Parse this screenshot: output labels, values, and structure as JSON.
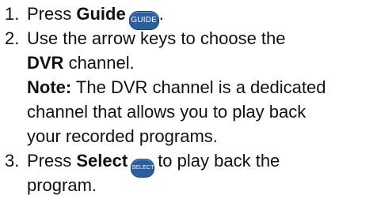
{
  "steps": [
    {
      "num": "1.",
      "pre": "Press ",
      "bold": "Guide",
      "button": "GUIDE",
      "post": "."
    },
    {
      "num": "2.",
      "line1": "Use the arrow keys to choose the",
      "bold": "DVR",
      "line2_post": " channel.",
      "note_label": "Note:",
      "note_line1": " The DVR channel is a dedicated",
      "note_line2": "channel that allows you to play back",
      "note_line3": "your recorded programs."
    },
    {
      "num": "3.",
      "pre": "Press ",
      "bold": "Select",
      "button": "SELECT",
      "post": "to play back the",
      "line2": "program."
    }
  ]
}
